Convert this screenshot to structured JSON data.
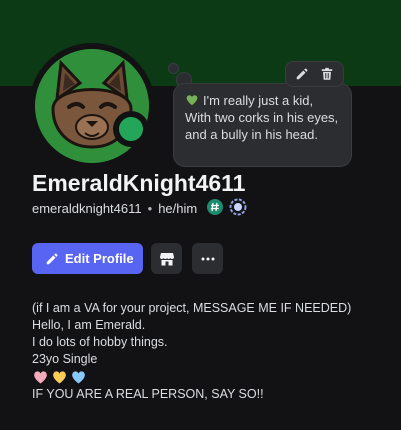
{
  "profile": {
    "display_name": "EmeraldKnight4611",
    "username": "emeraldknight4611",
    "separator": "•",
    "pronouns": "he/him",
    "status_color": "#23a55a",
    "banner_color": "#0b3a15"
  },
  "custom_status": {
    "emoji": "green-heart",
    "text": "I'm really just a kid, With two corks in his eyes, and a bully in his head."
  },
  "status_tools": [
    "edit-icon",
    "trash-icon"
  ],
  "badges": [
    "hashtag-badge",
    "quest-badge"
  ],
  "actions": {
    "edit_profile": "Edit Profile",
    "icon_buttons": [
      "shop-icon",
      "more-icon"
    ],
    "accent": "#5865f2"
  },
  "bio": {
    "lines": [
      "(if I am a VA for your project, MESSAGE ME IF NEEDED)",
      "Hello, I am Emerald.",
      "I do lots of hobby things.",
      "23yo Single"
    ],
    "hearts": [
      "pink-heart",
      "yellow-heart",
      "light-blue-heart"
    ],
    "last_line": "IF YOU ARE A REAL PERSON, SAY SO!!"
  }
}
